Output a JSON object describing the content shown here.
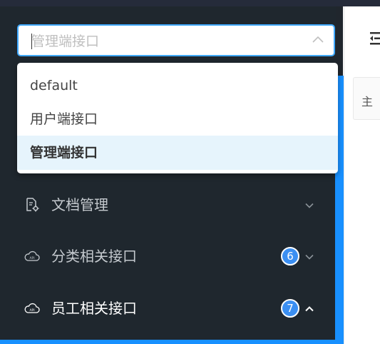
{
  "select": {
    "value": "管理端接口"
  },
  "dropdown": {
    "options": [
      {
        "label": "default"
      },
      {
        "label": "用户端接口"
      },
      {
        "label": "管理端接口"
      }
    ],
    "selected_index": 2
  },
  "menu": {
    "items": [
      {
        "icon": "document-gear-icon",
        "label": "文档管理",
        "badge": null,
        "expanded": false
      },
      {
        "icon": "api-cloud-icon",
        "label": "分类相关接口",
        "badge": "6",
        "expanded": false
      },
      {
        "icon": "api-cloud-icon",
        "label": "员工相关接口",
        "badge": "7",
        "expanded": true
      }
    ]
  },
  "main": {
    "tab_char": "主",
    "side_mark": "|"
  },
  "colors": {
    "sidebar_bg": "#1f272e",
    "accent": "#1890ff",
    "badge": "#3b8ff2",
    "selected_option_bg": "#e6f4fc"
  }
}
